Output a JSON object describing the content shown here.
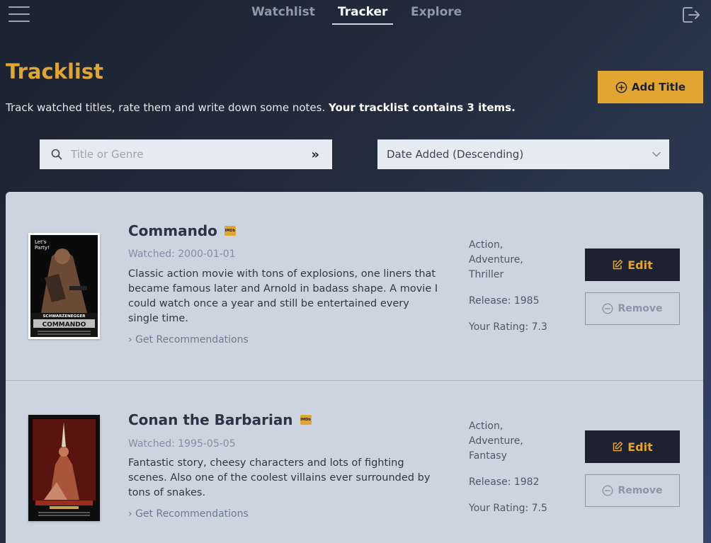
{
  "nav": {
    "tabs": [
      {
        "label": "Watchlist"
      },
      {
        "label": "Tracker"
      },
      {
        "label": "Explore"
      }
    ],
    "active_tab": "Tracker"
  },
  "header": {
    "title": "Tracklist",
    "subtitle_plain": "Track watched titles, rate them and write down some notes.",
    "subtitle_bold": "Your tracklist contains 3 items.",
    "add_label": "Add Title"
  },
  "search": {
    "placeholder": "Title or Genre",
    "submit_glyph": "»"
  },
  "sort": {
    "value": "Date Added (Descending)"
  },
  "items": [
    {
      "title": "Commando",
      "imdb_badge": "IMDb",
      "watched": "Watched: 2000-01-01",
      "description": "Classic action movie with tons of explosions, one liners that became famous later and Arnold in badass shape. A movie I could watch once a year and still be entertained every single time.",
      "recs_label": "Get Recommendations",
      "genres": [
        "Action,",
        "Adventure,",
        "Thriller"
      ],
      "release": "Release: 1985",
      "rating": "Your Rating: 7.3",
      "edit_label": "Edit",
      "remove_label": "Remove",
      "poster_text": [
        "Let's",
        "Party!",
        "SCHWARZENEGGER",
        "COMMANDO"
      ]
    },
    {
      "title": "Conan the Barbarian",
      "imdb_badge": "IMDb",
      "watched": "Watched: 1995-05-05",
      "description": "Fantastic story, cheesy characters and lots of fighting scenes. Also one of the coolest villains ever surrounded by tons of snakes.",
      "recs_label": "Get Recommendations",
      "genres": [
        "Action,",
        "Adventure,",
        "Fantasy"
      ],
      "release": "Release: 1982",
      "rating": "Your Rating: 7.5",
      "edit_label": "Edit",
      "remove_label": "Remove"
    }
  ],
  "colors": {
    "accent": "#e2a530",
    "dark": "#1c2232",
    "card": "#cbd4df"
  }
}
